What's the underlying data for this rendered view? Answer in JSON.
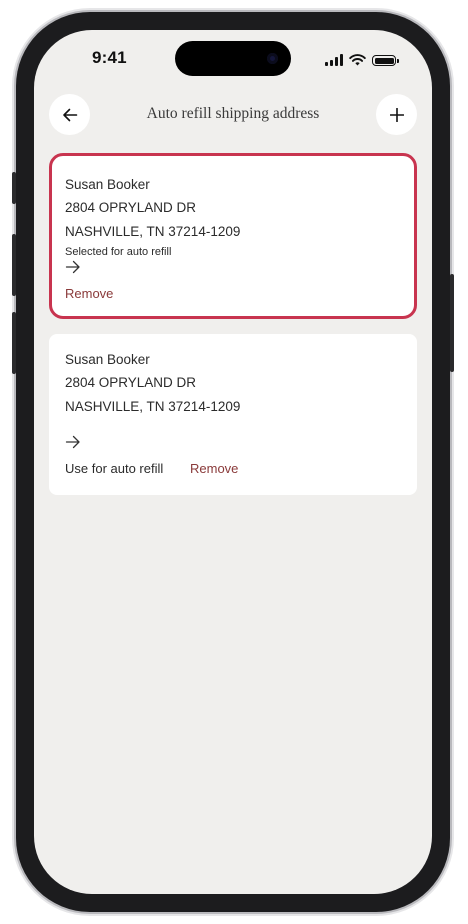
{
  "status_bar": {
    "time": "9:41",
    "icons": [
      "signal-icon",
      "wifi-icon",
      "battery-icon"
    ]
  },
  "header": {
    "title": "Auto refill shipping address",
    "back_icon": "arrow-left-icon",
    "add_icon": "plus-icon"
  },
  "addresses": [
    {
      "name": "Susan Booker",
      "street": "2804 OPRYLAND DR",
      "city_line": "NASHVILLE, TN 37214-1209",
      "status": "Selected for auto refill",
      "remove_label": "Remove",
      "selected": true
    },
    {
      "name": "Susan Booker",
      "street": "2804 OPRYLAND DR",
      "city_line": "NASHVILLE, TN 37214-1209",
      "use_label": "Use for auto refill",
      "remove_label": "Remove",
      "selected": false
    }
  ],
  "colors": {
    "background": "#f0efed",
    "card": "#ffffff",
    "selected_border": "#c8344f",
    "remove_text": "#8a3a3a",
    "text": "#2b2b2b"
  }
}
